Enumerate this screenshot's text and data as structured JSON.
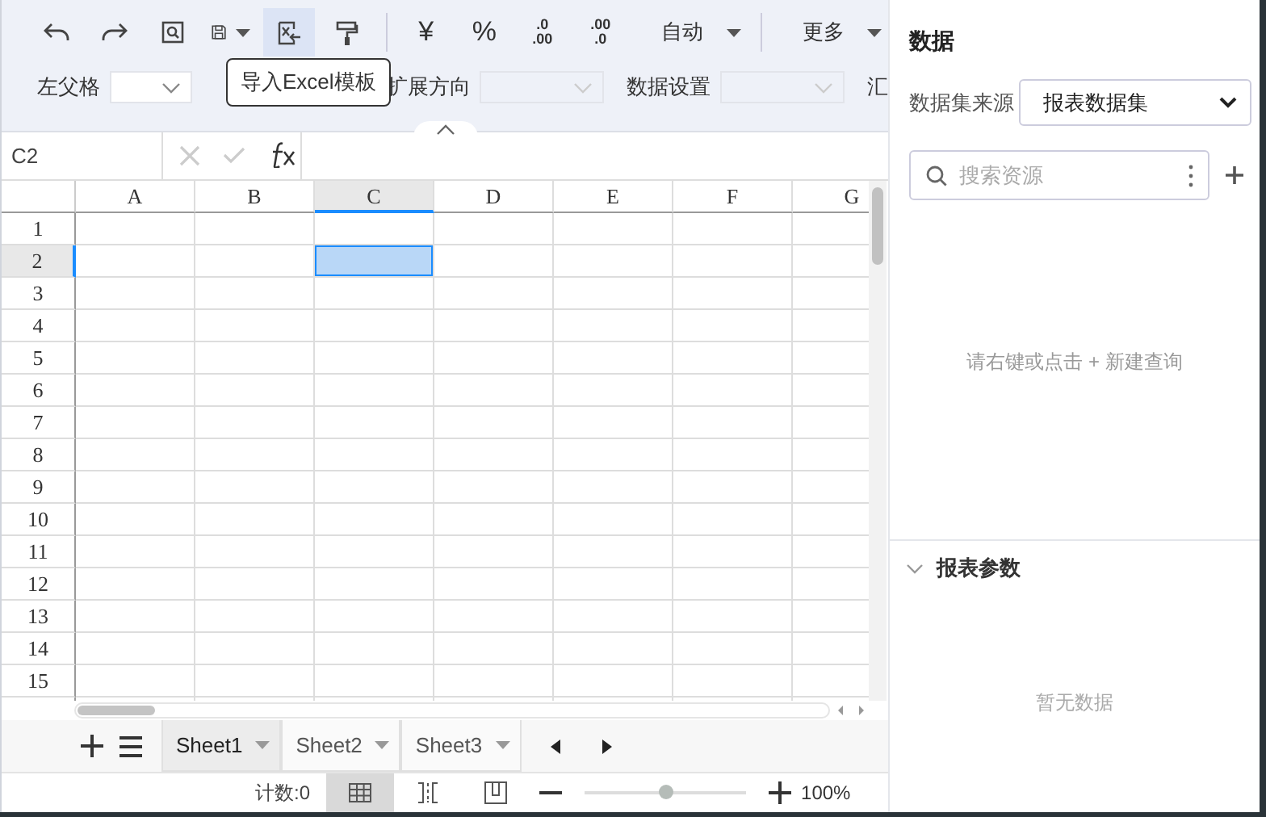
{
  "toolbar": {
    "tools": [
      {
        "kind": "undo",
        "highlighted": false
      },
      {
        "kind": "redo",
        "highlighted": false
      },
      {
        "kind": "preview",
        "highlighted": false
      },
      {
        "kind": "save",
        "highlighted": false
      },
      {
        "kind": "import",
        "highlighted": true
      },
      {
        "kind": "painter",
        "highlighted": false
      },
      {
        "kind": "separator"
      },
      {
        "kind": "text",
        "label": "¥",
        "highlighted": false
      },
      {
        "kind": "text",
        "label": "%",
        "highlighted": false
      },
      {
        "kind": "decimal-add",
        "top": ".0",
        "bottom": ".00",
        "highlighted": false
      },
      {
        "kind": "decimal-remove",
        "top": ".00",
        "bottom": ".0",
        "highlighted": false
      },
      {
        "kind": "dropdown",
        "label": "自动",
        "highlighted": false
      },
      {
        "kind": "separator"
      },
      {
        "kind": "dropdown",
        "label": "更多",
        "highlighted": false
      }
    ],
    "fields": [
      {
        "label": "左父格",
        "disabled": false
      },
      {
        "label": "扩展方向",
        "disabled": true
      },
      {
        "label": "数据设置",
        "disabled": true
      }
    ],
    "cut_label": "汇",
    "tooltip": "导入Excel模板"
  },
  "formula_bar": {
    "cell": "C2"
  },
  "grid": {
    "columns": [
      {
        "label": "A",
        "selected": false
      },
      {
        "label": "B",
        "selected": false
      },
      {
        "label": "C",
        "selected": true
      },
      {
        "label": "D",
        "selected": false
      },
      {
        "label": "E",
        "selected": false
      },
      {
        "label": "F",
        "selected": false
      },
      {
        "label": "G",
        "selected": false
      }
    ],
    "rows": [
      {
        "label": "1",
        "selected": false
      },
      {
        "label": "2",
        "selected": true
      },
      {
        "label": "3",
        "selected": false
      },
      {
        "label": "4",
        "selected": false
      },
      {
        "label": "5",
        "selected": false
      },
      {
        "label": "6",
        "selected": false
      },
      {
        "label": "7",
        "selected": false
      },
      {
        "label": "8",
        "selected": false
      },
      {
        "label": "9",
        "selected": false
      },
      {
        "label": "10",
        "selected": false
      },
      {
        "label": "11",
        "selected": false
      },
      {
        "label": "12",
        "selected": false
      },
      {
        "label": "13",
        "selected": false
      },
      {
        "label": "14",
        "selected": false
      },
      {
        "label": "15",
        "selected": false
      }
    ]
  },
  "sheet_tabs": [
    {
      "label": "Sheet1",
      "selected": true
    },
    {
      "label": "Sheet2",
      "selected": false
    },
    {
      "label": "Sheet3",
      "selected": false
    }
  ],
  "status_bar": {
    "count": "计数:0",
    "views": [
      {
        "kind": "normal",
        "selected": true
      },
      {
        "kind": "page-break",
        "selected": false
      },
      {
        "kind": "page-layout",
        "selected": false
      }
    ],
    "zoom_slider": {
      "level": 0.5
    },
    "zoom": "100%"
  },
  "panel": {
    "title": "数据",
    "source_label": "数据集来源",
    "source_value": "报表数据集",
    "search_placeholder": "搜索资源",
    "empty_hint": "请右键或点击 + 新建查询",
    "section": {
      "title": "报表参数",
      "expanded": true,
      "empty": "暂无数据"
    }
  }
}
